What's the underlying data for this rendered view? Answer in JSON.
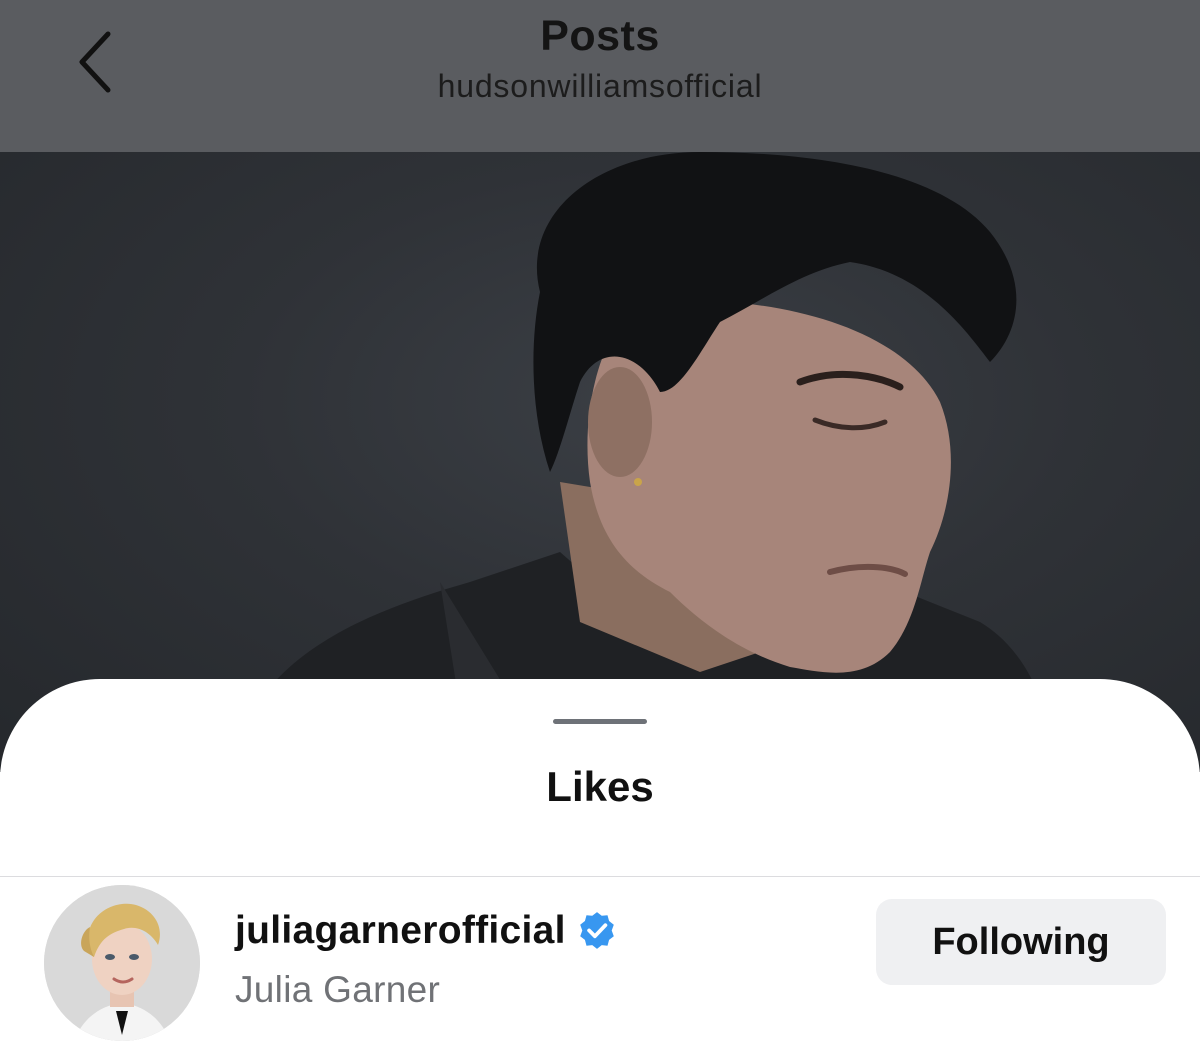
{
  "header": {
    "title": "Posts",
    "subtitle": "hudsonwilliamsofficial",
    "back_icon": "chevron-left-icon"
  },
  "post": {
    "image_subject": "portrait-photo"
  },
  "likes_sheet": {
    "title": "Likes",
    "items": [
      {
        "username": "juliagarnerofficial",
        "full_name": "Julia Garner",
        "verified": true,
        "verified_icon": "verified-badge-icon",
        "button_label": "Following"
      }
    ]
  },
  "colors": {
    "dimmed_header": "#5a5c60",
    "verified_blue": "#3897f0",
    "button_bg": "#eff0f2",
    "secondary_text": "#707276"
  }
}
